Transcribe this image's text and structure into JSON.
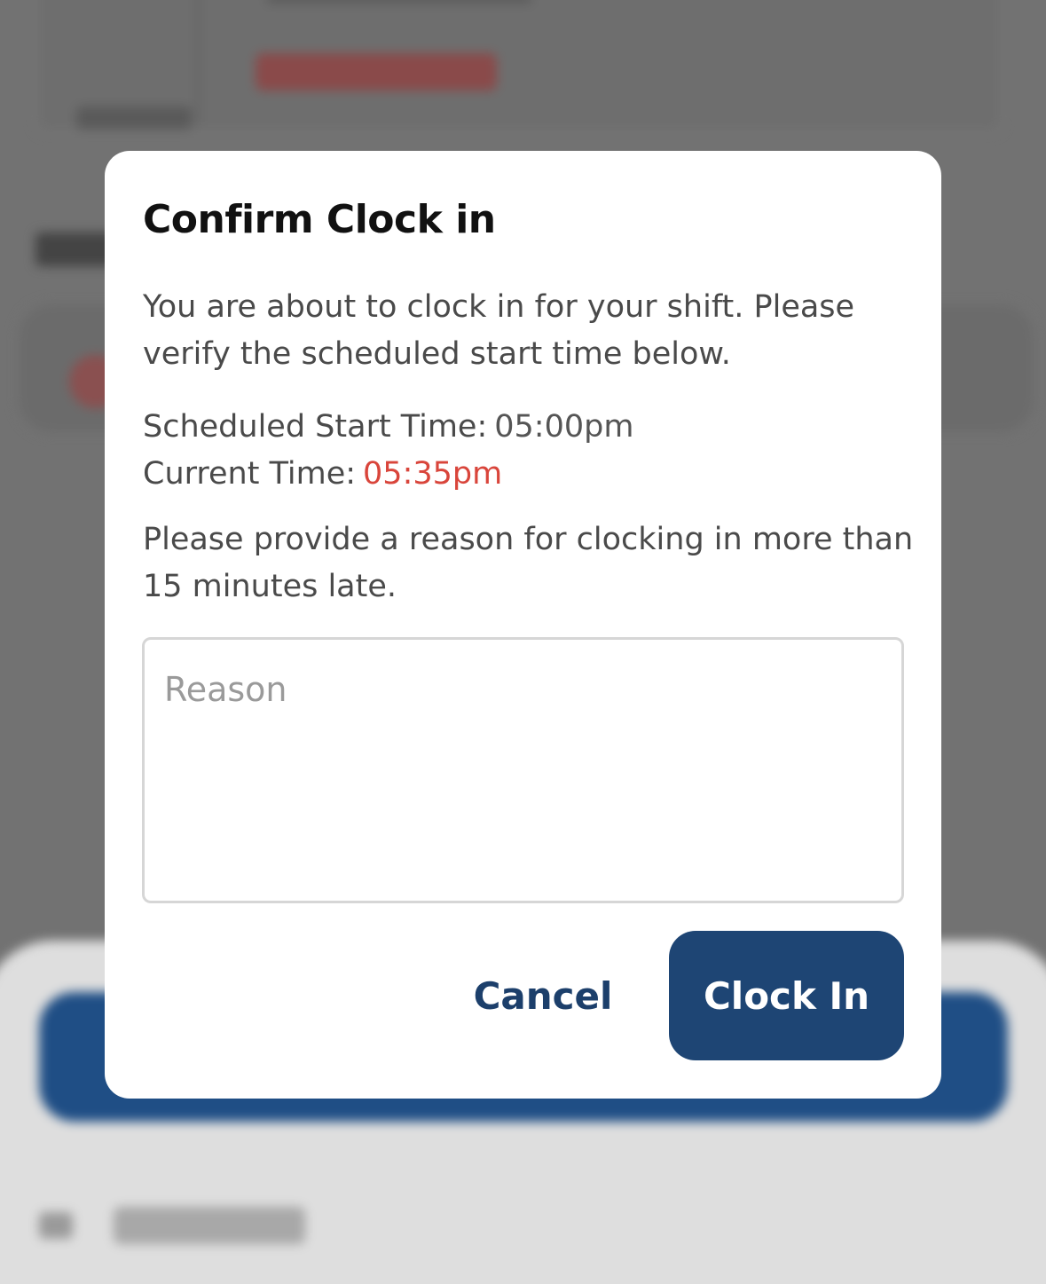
{
  "dialog": {
    "title": "Confirm Clock in",
    "message": "You are about to clock in for your shift. Please verify the scheduled start time below.",
    "scheduled_label": "Scheduled Start Time:",
    "scheduled_value": "05:00pm",
    "current_label": "Current Time:",
    "current_value": "05:35pm",
    "reason_prompt": "Please provide a reason for clocking in more than 15 minutes late.",
    "reason_placeholder": "Reason",
    "reason_value": "",
    "cancel_label": "Cancel",
    "confirm_label": "Clock In"
  },
  "colors": {
    "primary": "#1e4574",
    "late": "#d9453b",
    "overlay": "#727272"
  }
}
